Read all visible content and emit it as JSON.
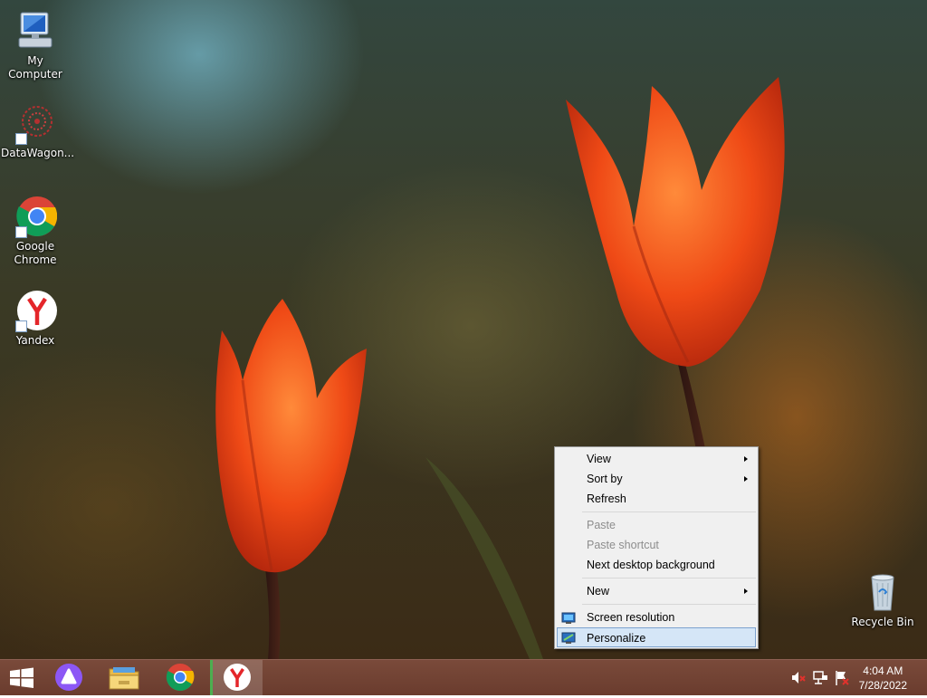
{
  "desktop_icons": [
    {
      "label": "My Computer",
      "icon": "computer-icon"
    },
    {
      "label": "DataWagon...",
      "icon": "datawagon-icon"
    },
    {
      "label": "Google Chrome",
      "icon": "chrome-icon"
    },
    {
      "label": "Yandex",
      "icon": "yandex-icon"
    },
    {
      "label": "Recycle Bin",
      "icon": "recycle-bin-icon"
    }
  ],
  "context_menu": {
    "items": [
      {
        "label": "View",
        "submenu": true,
        "disabled": false
      },
      {
        "label": "Sort by",
        "submenu": true,
        "disabled": false
      },
      {
        "label": "Refresh",
        "submenu": false,
        "disabled": false
      },
      {
        "label": "Paste",
        "submenu": false,
        "disabled": true
      },
      {
        "label": "Paste shortcut",
        "submenu": false,
        "disabled": true
      },
      {
        "label": "Next desktop background",
        "submenu": false,
        "disabled": false
      },
      {
        "label": "New",
        "submenu": true,
        "disabled": false
      },
      {
        "label": "Screen resolution",
        "submenu": false,
        "disabled": false,
        "icon": "monitor-icon"
      },
      {
        "label": "Personalize",
        "submenu": false,
        "disabled": false,
        "icon": "personalize-icon",
        "highlighted": true
      }
    ]
  },
  "taskbar": {
    "start_icon": "windows-logo-icon",
    "apps": [
      "alice-assistant-icon",
      "file-explorer-icon",
      "chrome-icon",
      "yandex-browser-icon"
    ],
    "active_app": "yandex-browser-icon",
    "tray_icons": [
      "volume-muted-icon",
      "network-icon",
      "action-center-flag-icon"
    ],
    "time": "4:04 AM",
    "date": "7/28/2022"
  },
  "colors": {
    "taskbar": "#6e4132",
    "menu_bg": "#f0f0f0",
    "menu_highlight": "#d5e6f7",
    "menu_highlight_border": "#7da2ce",
    "active_app_indicator": "#4caf50"
  }
}
